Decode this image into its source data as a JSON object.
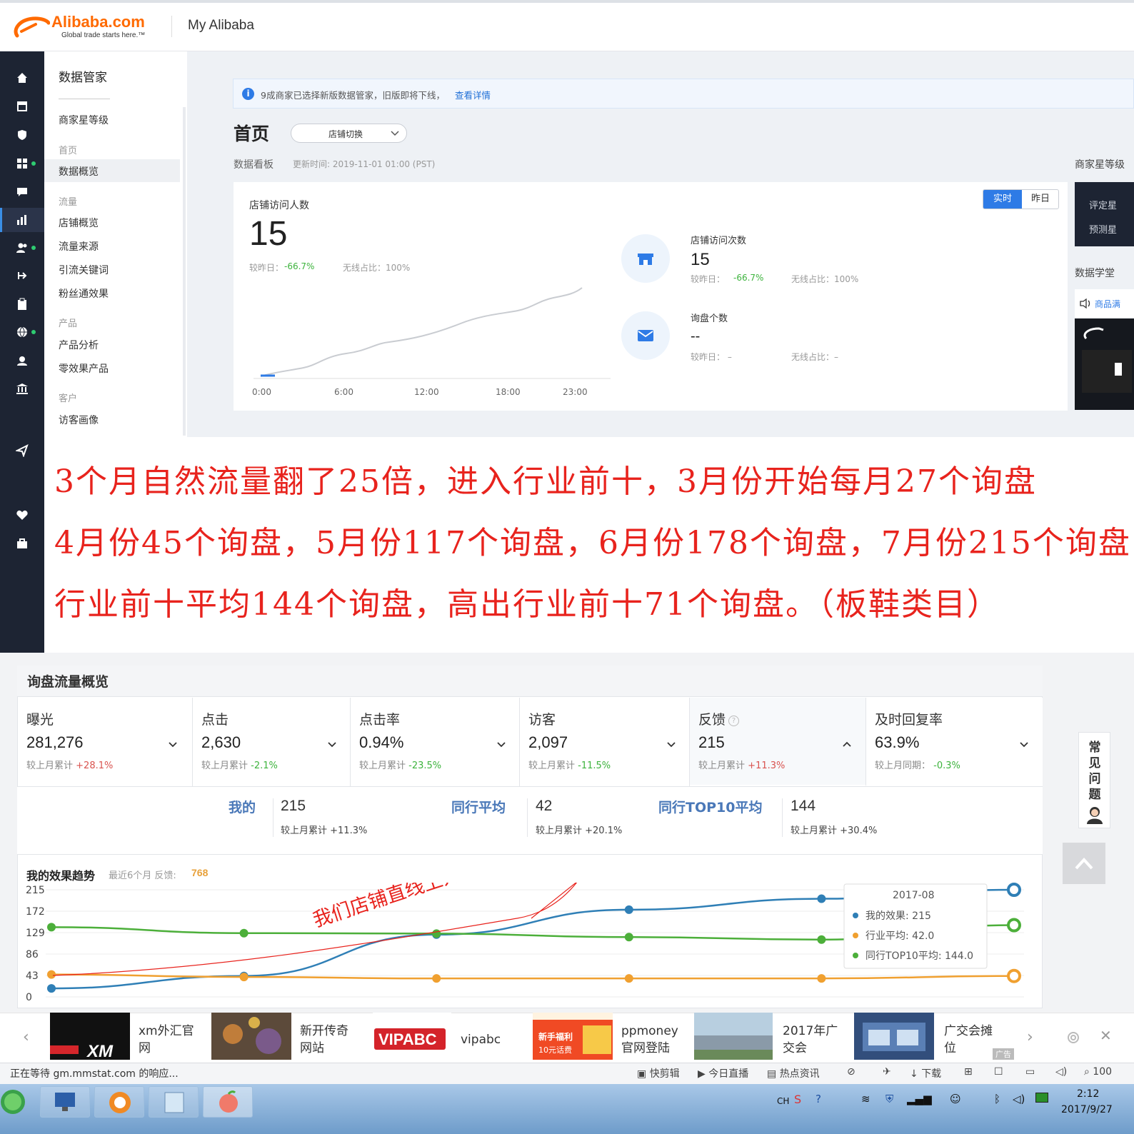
{
  "header": {
    "logo_word": "Alibaba.com",
    "logo_tagline": "Global trade starts here.™",
    "title": "My Alibaba"
  },
  "menu": {
    "title": "数据管家",
    "star_level": "商家星等级",
    "groups": [
      {
        "label": "首页",
        "items": [
          "数据概览"
        ]
      },
      {
        "label": "流量",
        "items": [
          "店铺概览",
          "流量来源",
          "引流关键词",
          "粉丝通效果"
        ]
      },
      {
        "label": "产品",
        "items": [
          "产品分析",
          "零效果产品"
        ]
      },
      {
        "label": "客户",
        "items": [
          "访客画像"
        ]
      }
    ],
    "selected": "数据概览"
  },
  "notice": {
    "text": "9成商家已选择新版数据管家，旧版即将下线，",
    "link": "查看详情"
  },
  "page": {
    "title": "首页",
    "store_switch": "店铺切换",
    "board_label": "数据看板",
    "update_time": "更新时间: 2019-11-01 01:00 (PST)"
  },
  "realtime": {
    "seg_on": "实时",
    "seg_off": "昨日",
    "visitors_label": "店铺访问人数",
    "visitors_value": "15",
    "visitors_cmp_label": "较昨日：",
    "visitors_cmp": "-66.7%",
    "visitors_mobile": "无线占比：100%",
    "x_ticks": [
      "0:00",
      "6:00",
      "12:00",
      "18:00",
      "23:00"
    ],
    "visits_label": "店铺访问次数",
    "visits_value": "15",
    "visits_cmp_label": "较昨日：",
    "visits_cmp": "-66.7%",
    "visits_mobile": "无线占比：100%",
    "inq_label": "询盘个数",
    "inq_value": "--",
    "inq_cmp": "较昨日： –",
    "inq_mobile": "无线占比：–"
  },
  "right_panel": {
    "star_label": "商家星等级",
    "row1": "评定星",
    "row2": "预测星",
    "learn": "数据学堂",
    "learn_item": "商品满"
  },
  "overlay": {
    "lines": [
      "3个月自然流量翻了25倍，进入行业前十，3月份开始每月27个询盘",
      "4月份45个询盘，5月份117个询盘，6月份178个询盘，7月份215个询盘",
      "行业前十平均144个询盘，高出行业前十71个询盘。（板鞋类目）"
    ],
    "annotation": "我们店铺直线上升"
  },
  "inquiry": {
    "title": "询盘流量概览",
    "kpis": [
      {
        "label": "曝光",
        "value": "281,276",
        "cmp_label": "较上月累计",
        "cmp": "+28.1%"
      },
      {
        "label": "点击",
        "value": "2,630",
        "cmp_label": "较上月累计",
        "cmp": "-2.1%"
      },
      {
        "label": "点击率",
        "value": "0.94%",
        "cmp_label": "较上月累计",
        "cmp": "-23.5%"
      },
      {
        "label": "访客",
        "value": "2,097",
        "cmp_label": "较上月累计",
        "cmp": "-11.5%"
      },
      {
        "label": "反馈",
        "value": "215",
        "cmp_label": "较上月累计",
        "cmp": "+11.3%"
      },
      {
        "label": "及时回复率",
        "value": "63.9%",
        "cmp_label": "较上月同期：",
        "cmp": "-0.3%"
      }
    ],
    "compare": [
      {
        "name": "我的",
        "value": "215",
        "sub": "较上月累计 +11.3%"
      },
      {
        "name": "同行平均",
        "value": "42",
        "sub": "较上月累计 +20.1%"
      },
      {
        "name": "同行TOP10平均",
        "value": "144",
        "sub": "较上月累计 +30.4%"
      }
    ],
    "trend_title": "我的效果趋势",
    "trend_sub": "最近6个月 反馈:",
    "trend_total": "768",
    "tooltip": {
      "month": "2017-08",
      "mine": "我的效果: 215",
      "industry": "行业平均: 42.0",
      "top10": "同行TOP10平均: 144.0"
    }
  },
  "chart_data": {
    "type": "line",
    "yticks": [
      0,
      43,
      86,
      129,
      172,
      215
    ],
    "ylim": [
      0,
      215
    ],
    "series": [
      {
        "name": "我的效果",
        "color": "#2f7fb6",
        "values": [
          17,
          42,
          125,
          175,
          197,
          215
        ]
      },
      {
        "name": "行业平均",
        "color": "#f0a030",
        "values": [
          45,
          40,
          37,
          37,
          37,
          42
        ]
      },
      {
        "name": "同行TOP10平均",
        "color": "#4caf3a",
        "values": [
          140,
          128,
          127,
          120,
          115,
          144
        ]
      }
    ]
  },
  "faq": [
    "常",
    "见",
    "问",
    "题"
  ],
  "ads": [
    {
      "text1": "xm外汇官",
      "text2": "网"
    },
    {
      "text1": "新开传奇",
      "text2": "网站"
    },
    {
      "text1": "vipabc",
      "text2": ""
    },
    {
      "text1": "ppmoney",
      "text2": "官网登陆"
    },
    {
      "text1": "2017年广",
      "text2": "交会"
    },
    {
      "text1": "广交会摊",
      "text2": "位"
    }
  ],
  "ad_logos": {
    "xm": "XM",
    "vipabc": "VIPABC",
    "ppmoney_banner1": "新手福利",
    "ppmoney_banner2": "10元话费"
  },
  "ad_badge": "广告",
  "statusbar": {
    "text": "正在等待 gm.mmstat.com 的响应...",
    "items": [
      "快剪辑",
      "今日直播",
      "热点资讯",
      "下载",
      "100"
    ]
  },
  "taskbar": {
    "lang": "CH",
    "time": "2:12",
    "date": "2017/9/27"
  }
}
